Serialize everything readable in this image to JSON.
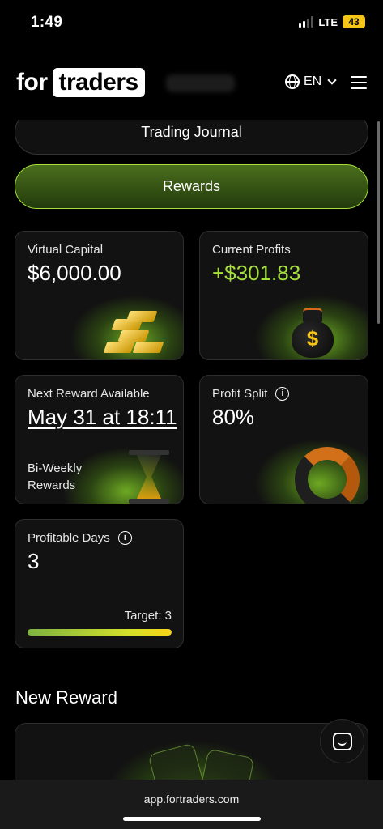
{
  "status": {
    "time": "1:49",
    "network": "LTE",
    "battery": "43"
  },
  "header": {
    "logo_for": "for",
    "logo_traders": "traders",
    "language": "EN"
  },
  "nav": {
    "trading_journal": "Trading Journal",
    "rewards": "Rewards"
  },
  "cards": {
    "virtual_capital": {
      "label": "Virtual Capital",
      "value": "$6,000.00"
    },
    "current_profits": {
      "label": "Current Profits",
      "value": "+$301.83"
    },
    "next_reward": {
      "label": "Next Reward Available",
      "value": "May 31 at 18:11",
      "note": "Bi-Weekly Rewards"
    },
    "profit_split": {
      "label": "Profit Split",
      "value": "80%"
    },
    "profitable_days": {
      "label": "Profitable Days",
      "value": "3",
      "target": "Target: 3",
      "progress": 1.0
    }
  },
  "section": {
    "new_reward": "New Reward"
  },
  "browser": {
    "url": "app.fortraders.com"
  },
  "colors": {
    "accent_green": "#a6e03a",
    "background": "#000000",
    "card_bg": "#121212",
    "gold": "#f5c518"
  },
  "icons": {
    "globe": "globe-icon",
    "menu": "hamburger-menu-icon",
    "info": "info-icon",
    "chat": "chat-icon"
  }
}
